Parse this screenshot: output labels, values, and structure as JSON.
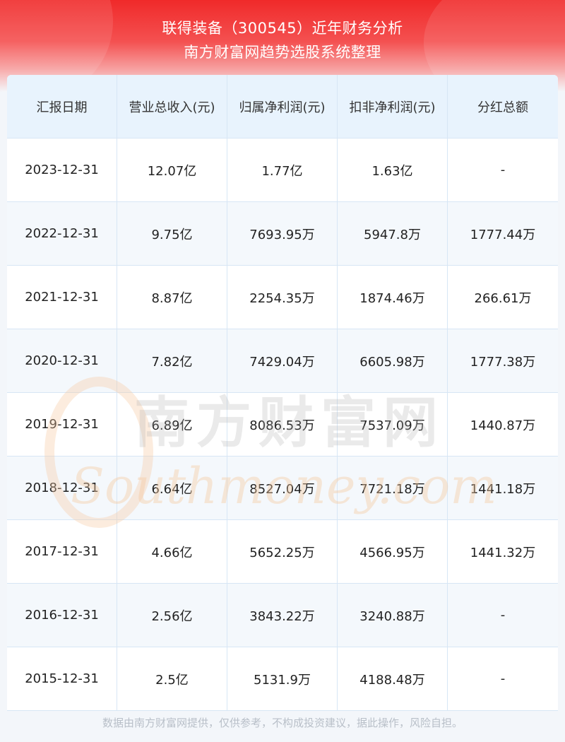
{
  "header": {
    "title_line1": "联得装备（300545）近年财务分析",
    "title_line2": "南方财富网趋势选股系统整理"
  },
  "table": {
    "columns": [
      "汇报日期",
      "营业总收入(元)",
      "归属净利润(元)",
      "扣非净利润(元)",
      "分红总额"
    ],
    "rows": [
      [
        "2023-12-31",
        "12.07亿",
        "1.77亿",
        "1.63亿",
        "-"
      ],
      [
        "2022-12-31",
        "9.75亿",
        "7693.95万",
        "5947.8万",
        "1777.44万"
      ],
      [
        "2021-12-31",
        "8.87亿",
        "2254.35万",
        "1874.46万",
        "266.61万"
      ],
      [
        "2020-12-31",
        "7.82亿",
        "7429.04万",
        "6605.98万",
        "1777.38万"
      ],
      [
        "2019-12-31",
        "6.89亿",
        "8086.53万",
        "7537.09万",
        "1440.87万"
      ],
      [
        "2018-12-31",
        "6.64亿",
        "8527.04万",
        "7721.18万",
        "1441.18万"
      ],
      [
        "2017-12-31",
        "4.66亿",
        "5652.25万",
        "4566.95万",
        "1441.32万"
      ],
      [
        "2016-12-31",
        "2.56亿",
        "3843.22万",
        "3240.88万",
        "-"
      ],
      [
        "2015-12-31",
        "2.5亿",
        "5131.9万",
        "4188.48万",
        "-"
      ]
    ]
  },
  "watermark": {
    "cn_text": "南方财富网",
    "en_text": "Southmoney.com"
  },
  "footer": {
    "disclaimer": "数据由南方财富网提供，仅供参考，不构成投资建议，据此操作，风险自担。"
  },
  "colors": {
    "header_red": "#f02a2a",
    "table_head_bg": "#e8f3fd",
    "grid_line": "#d7e6f5",
    "watermark_orange": "#f5c9a0"
  }
}
